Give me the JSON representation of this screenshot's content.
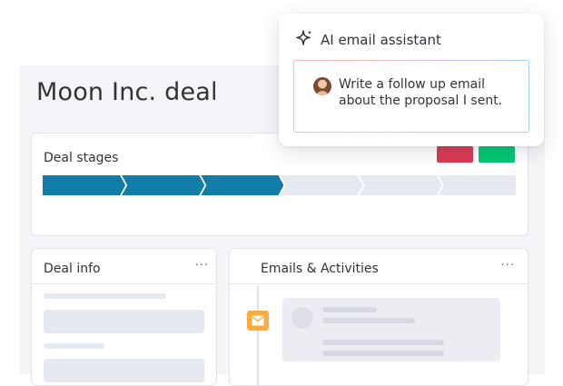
{
  "deal": {
    "title": "Moon Inc. deal"
  },
  "deal_stages": {
    "title": "Deal stages",
    "tags": [
      {
        "name": "red-tag",
        "color": "#d83a52"
      },
      {
        "name": "green-tag",
        "color": "#00c875"
      }
    ],
    "stages_total": 6,
    "stages_completed": 3,
    "colors": {
      "completed": "#127ea7",
      "pending": "#e6e9ef"
    }
  },
  "deal_info": {
    "title": "Deal info",
    "more_label": "···"
  },
  "activities": {
    "title": "Emails & Activities",
    "more_label": "···",
    "badge_icon": "mail-icon",
    "badge_color": "#fdab3d"
  },
  "ai_assistant": {
    "icon": "sparkle-icon",
    "title": "AI email assistant",
    "prompt_text": "Write a follow up email about the proposal I sent."
  }
}
